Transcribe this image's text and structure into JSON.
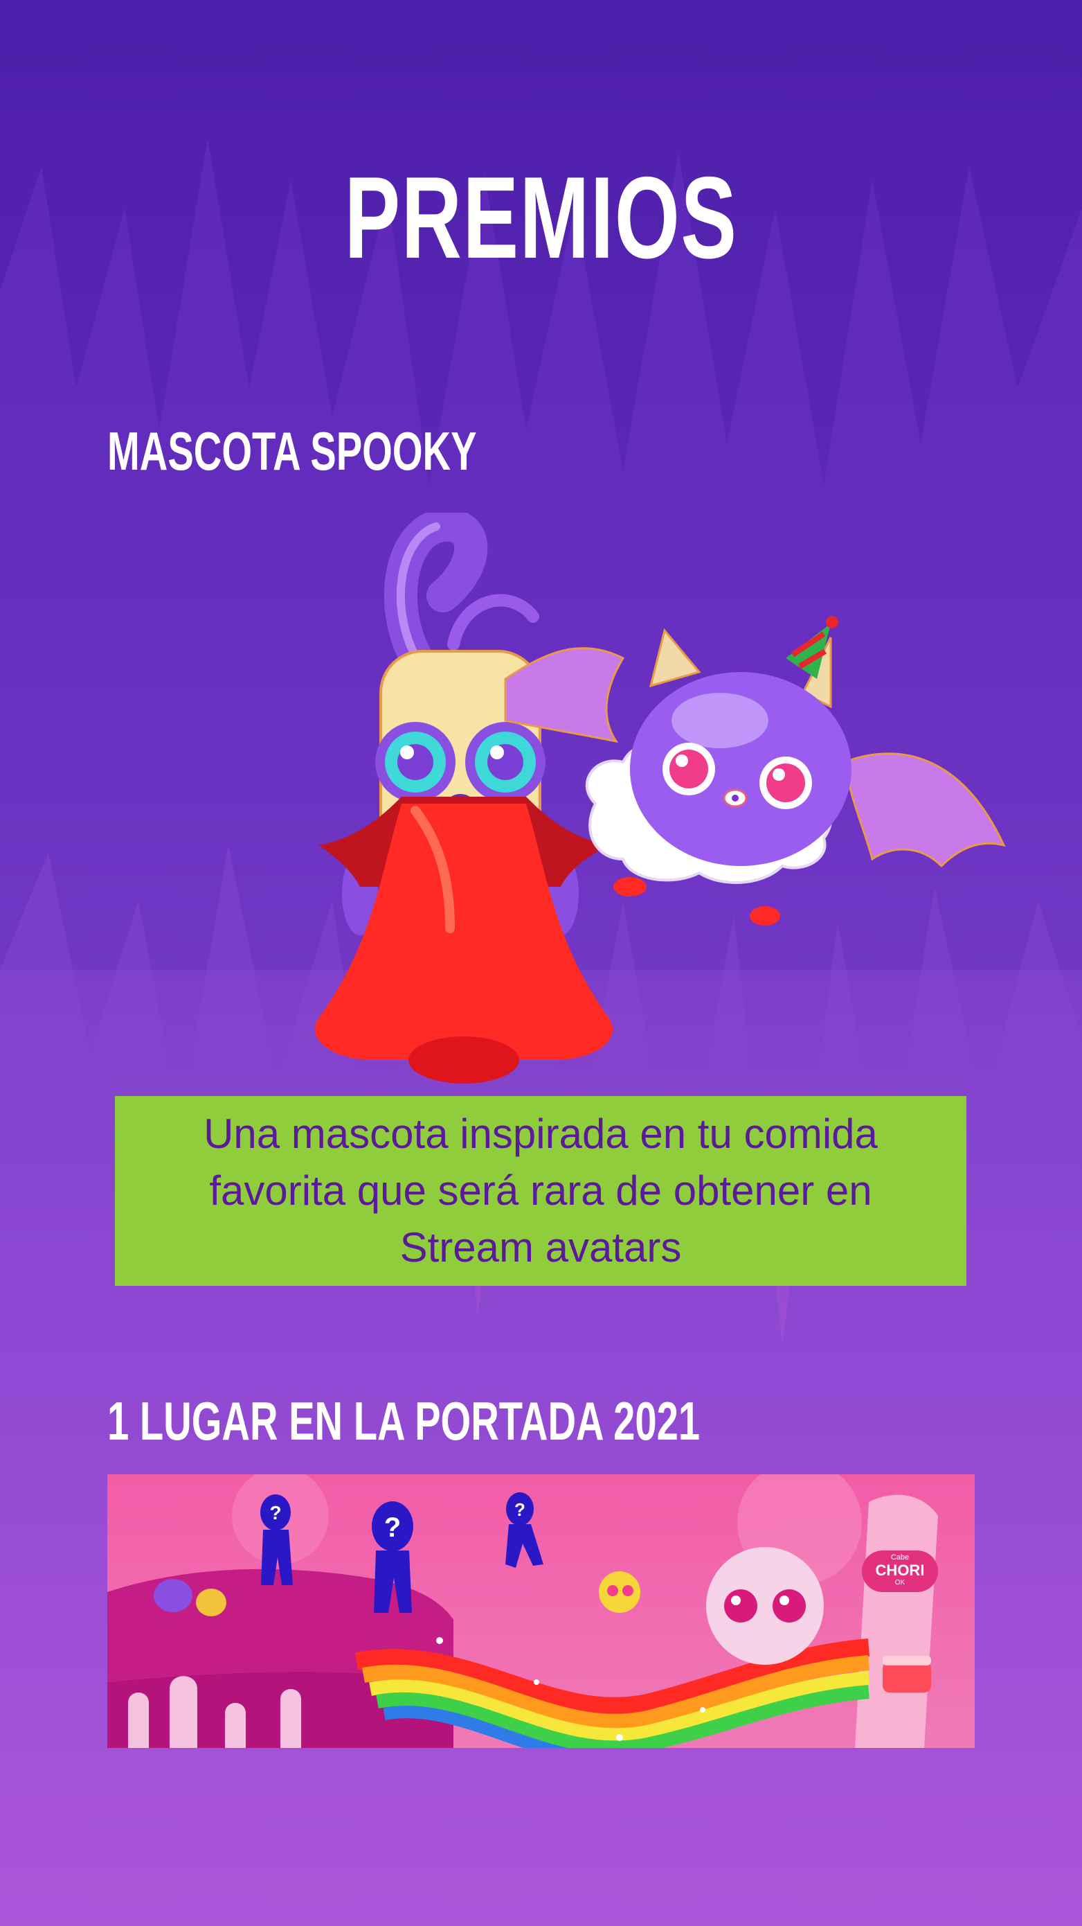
{
  "page": {
    "title": "PREMIOS"
  },
  "prize_1": {
    "heading": "MASCOTA SPOOKY",
    "description_lines": [
      "Una mascota inspirada en tu comida",
      "favorita que será rara de obtener en",
      "Stream avatars"
    ]
  },
  "prize_2": {
    "heading": "1 LUGAR EN LA PORTADA 2021",
    "banner_logo": "CHORI",
    "banner_logo_small_top": "Cabe",
    "banner_logo_small_bottom": "OK"
  },
  "colors": {
    "background_top": "#4b1fa9",
    "background_bottom": "#d96ae4",
    "description_box": "#8fcd3d",
    "description_text": "#5b1a9a",
    "banner_pink": "#f25ca6"
  },
  "icons": {
    "mascot_1": "vampire-chorizo-mascot",
    "mascot_2": "bat-jelly-mascot",
    "mystery_person": "question-silhouette-icon"
  }
}
